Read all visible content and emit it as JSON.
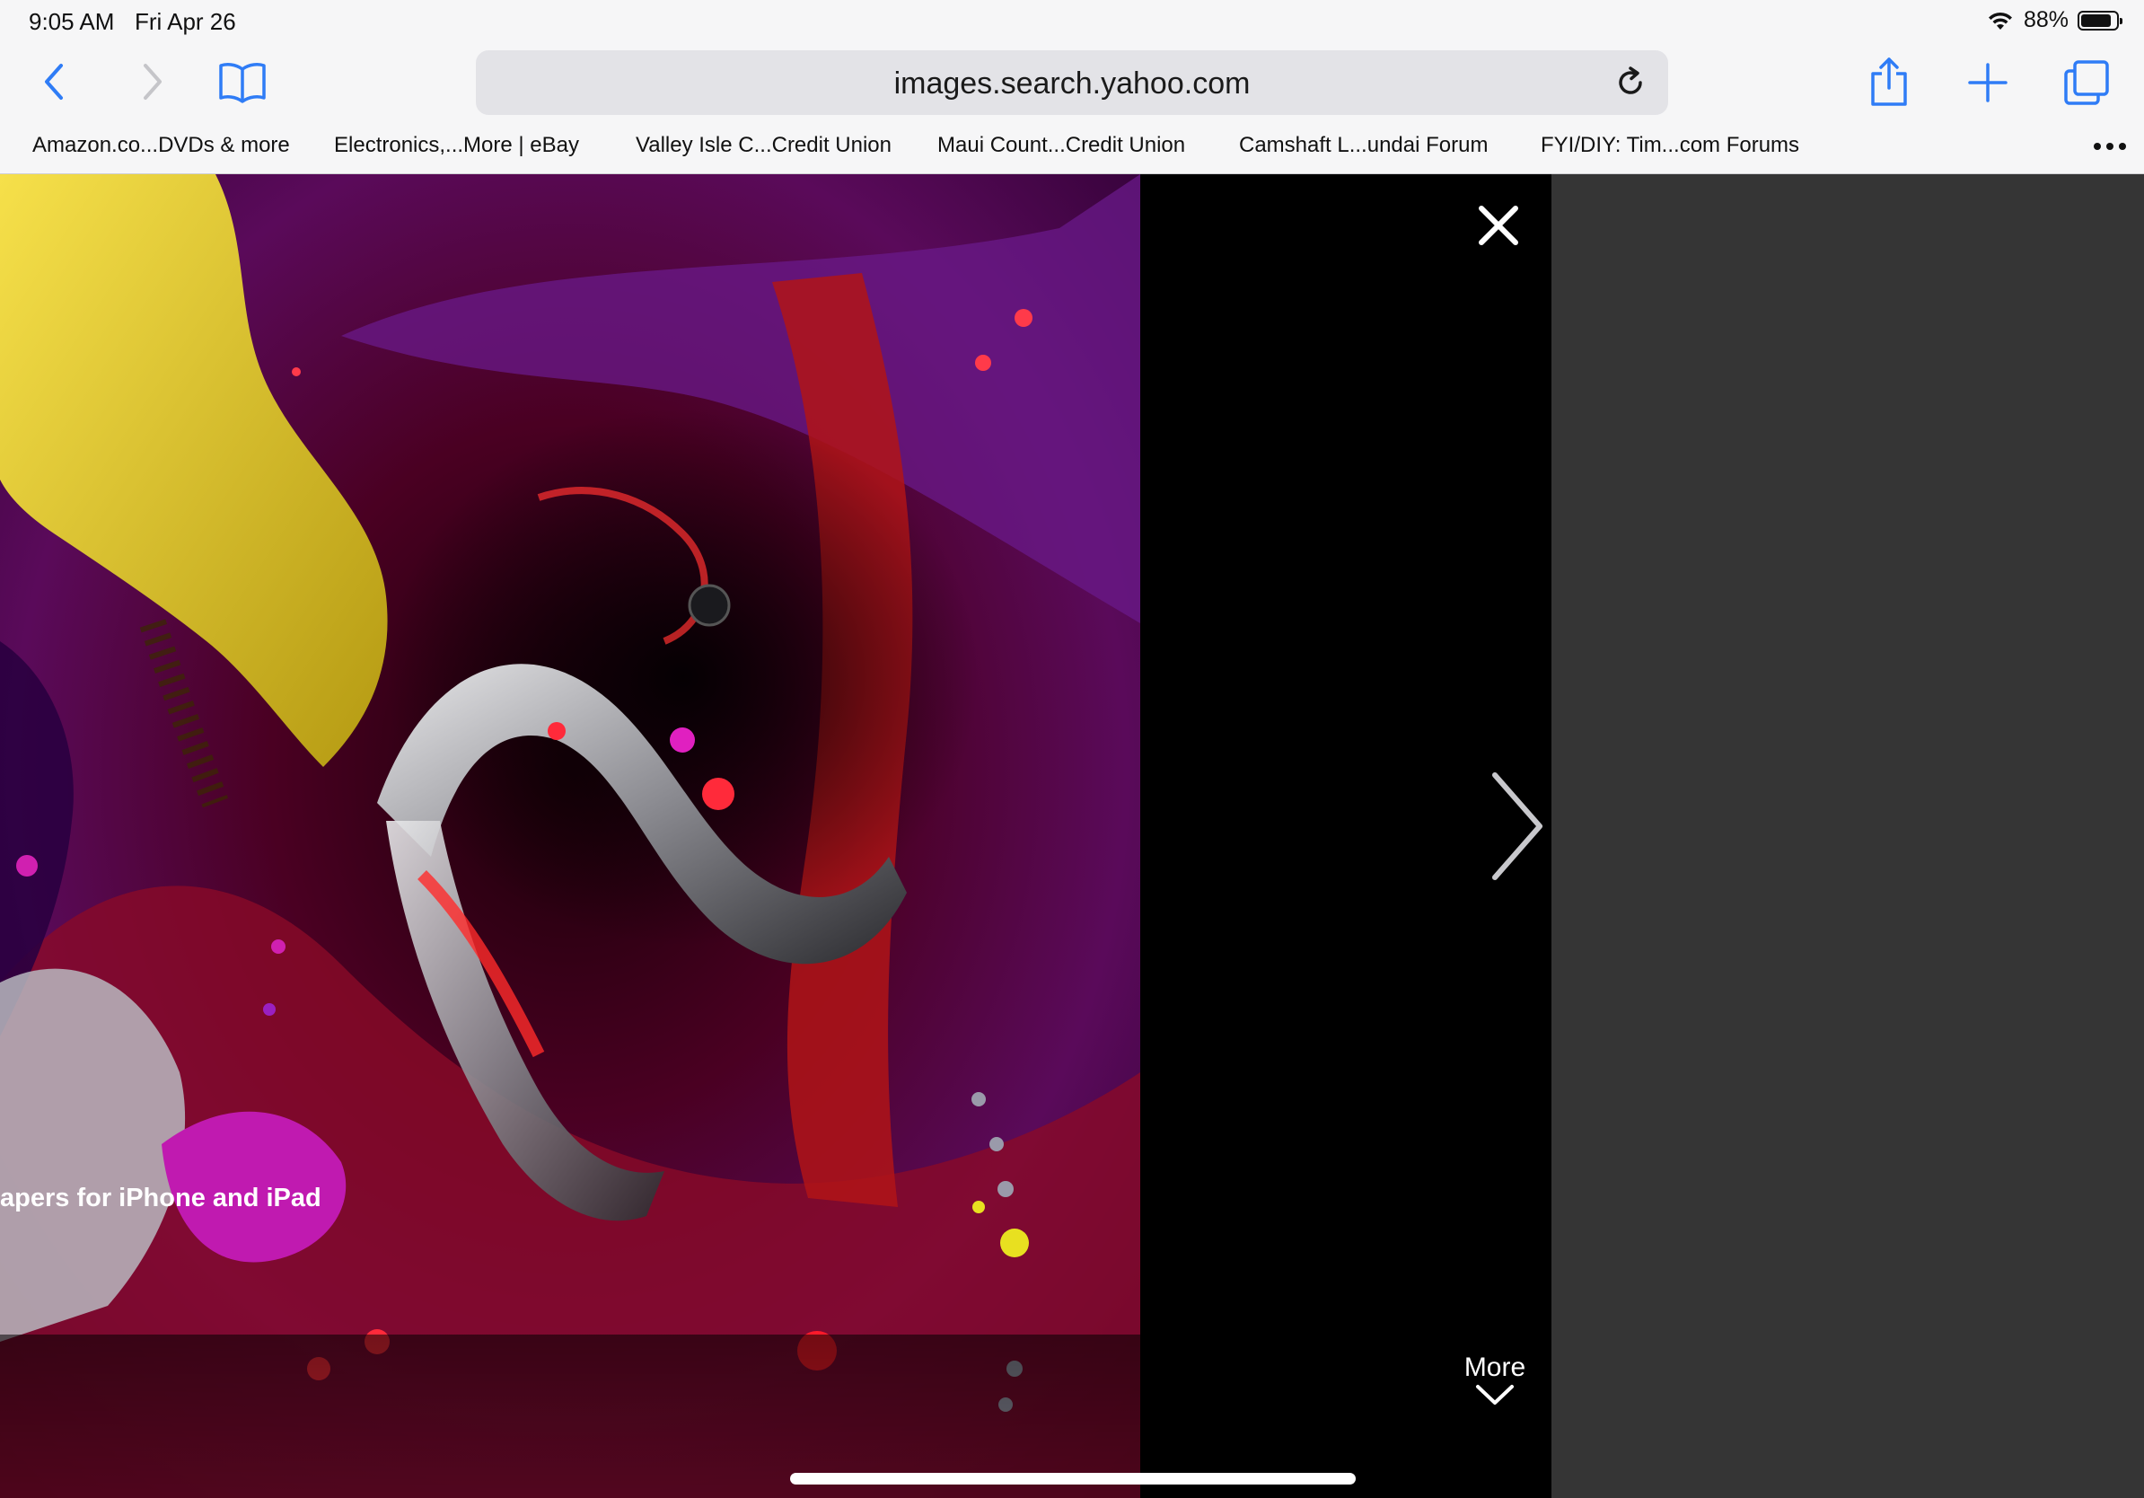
{
  "status": {
    "time": "9:05 AM",
    "date": "Fri Apr 26",
    "battery_pct": "88%",
    "battery_level": 0.88
  },
  "toolbar": {
    "url": "images.search.yahoo.com",
    "icons": [
      "back-icon",
      "forward-icon",
      "bookmarks-icon",
      "reload-icon",
      "share-icon",
      "new-tab-icon",
      "tabs-icon"
    ],
    "accent": "#2f7cf6"
  },
  "bookmarks": [
    "Amazon.co...DVDs & more",
    "Electronics,...More | eBay",
    "Valley Isle C...Credit Union",
    "Maui Count...Credit Union",
    "Camshaft L...undai Forum",
    "FYI/DIY: Tim...com Forums"
  ],
  "viewer": {
    "caption": "apers for iPhone and iPad",
    "more_label": "More",
    "icons": [
      "close-icon",
      "chevron-right-icon",
      "chevron-down-icon"
    ]
  }
}
